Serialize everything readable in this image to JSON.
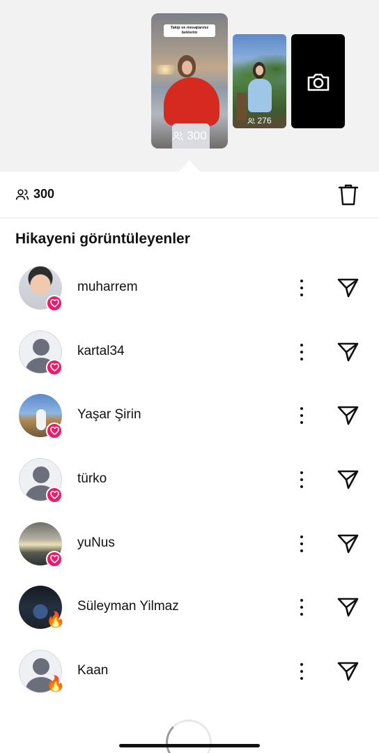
{
  "stories": {
    "current": {
      "sticker_text": "Takip ve mesajlarınız beklerim",
      "views": "300"
    },
    "second": {
      "views": "276"
    },
    "camera_icon": "camera-icon"
  },
  "stats": {
    "viewer_count": "300",
    "viewers_icon": "people-icon",
    "delete_icon": "trash-icon"
  },
  "section_title": "Hikayeni görüntüleyenler",
  "viewers": [
    {
      "name": "muharrem",
      "reaction": "heart",
      "avatar": "photo"
    },
    {
      "name": "kartal34",
      "reaction": "heart",
      "avatar": "default"
    },
    {
      "name": "Yaşar Şirin",
      "reaction": "heart",
      "avatar": "photo"
    },
    {
      "name": "türko",
      "reaction": "heart",
      "avatar": "default"
    },
    {
      "name": "yuNus",
      "reaction": "heart",
      "avatar": "photo"
    },
    {
      "name": "Süleyman Yilmaz",
      "reaction": "fire",
      "avatar": "photo"
    },
    {
      "name": "Kaan",
      "reaction": "fire",
      "avatar": "default"
    }
  ],
  "colors": {
    "heart_badge": "#ee1a6a",
    "top_background": "#f2f2f2"
  }
}
